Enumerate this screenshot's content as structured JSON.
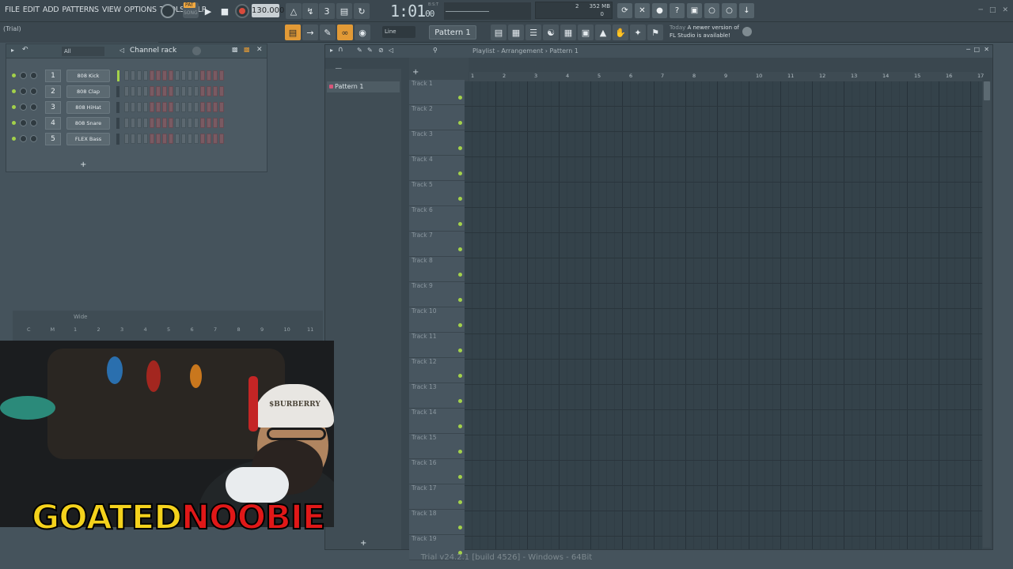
{
  "menu": [
    "FILE",
    "EDIT",
    "ADD",
    "PATTERNS",
    "VIEW",
    "OPTIONS",
    "TOOLS",
    "HELP"
  ],
  "hint": "(Trial)",
  "transport": {
    "pat": "PAT",
    "song": "SONG",
    "tempo": "130.000",
    "time": "1:01",
    "time_sub": "00",
    "bst": "B:S:T"
  },
  "cpu": {
    "poly": "2",
    "mem": "352 MB",
    "zero": "0"
  },
  "toolbar": {
    "snap": "Line",
    "pattern": "Pattern 1"
  },
  "news": {
    "today": "Today",
    "msg1": "A newer version of",
    "msg2": "FL Studio is available!"
  },
  "channel_rack": {
    "title": "Channel rack",
    "filter": "All",
    "channels": [
      {
        "num": "1",
        "name": "808 Kick"
      },
      {
        "num": "2",
        "name": "808 Clap"
      },
      {
        "num": "3",
        "name": "808 HiHat"
      },
      {
        "num": "4",
        "name": "808 Snare"
      },
      {
        "num": "5",
        "name": "FLEX Bass"
      }
    ],
    "add": "+"
  },
  "playlist": {
    "crumb": "Playlist - Arrangement › Pattern 1",
    "pattern_item": "Pattern 1",
    "ruler": [
      "1",
      "2",
      "3",
      "4",
      "5",
      "6",
      "7",
      "8",
      "9",
      "10",
      "11",
      "12",
      "13",
      "14",
      "15",
      "16",
      "17"
    ],
    "tracks": [
      "Track 1",
      "Track 2",
      "Track 3",
      "Track 4",
      "Track 5",
      "Track 6",
      "Track 7",
      "Track 8",
      "Track 9",
      "Track 10",
      "Track 11",
      "Track 12",
      "Track 13",
      "Track 14",
      "Track 15",
      "Track 16",
      "Track 17",
      "Track 18",
      "Track 19"
    ],
    "add": "+"
  },
  "mixer": {
    "label": "Wide",
    "nums": [
      "C",
      "M",
      "1",
      "2",
      "3",
      "4",
      "5",
      "6",
      "7",
      "8",
      "9",
      "10",
      "11"
    ]
  },
  "overlay": {
    "logo_a": "GOATED",
    "logo_b": "NOOBIE",
    "cap": "$BURBERRY"
  },
  "status": "Trial v24.2.1 [build 4526] - Windows - 64Bit",
  "colors": {
    "accent": "#e29a36",
    "led": "#a3d14a",
    "bg": "#45535c"
  }
}
